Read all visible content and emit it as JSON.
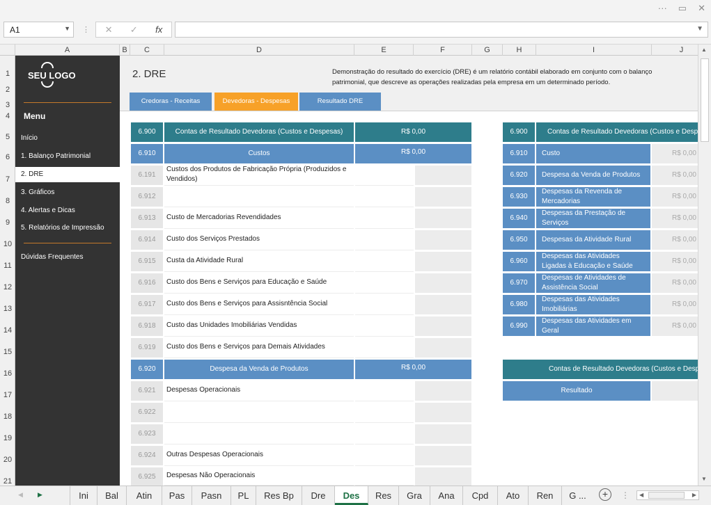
{
  "window": {
    "controls": [
      "···",
      "▭",
      "✕"
    ]
  },
  "formula_bar": {
    "name_box": "A1",
    "fx": "fx",
    "cancel": "✕",
    "confirm": "✓",
    "value": ""
  },
  "columns": [
    "A",
    "B",
    "C",
    "D",
    "E",
    "F",
    "G",
    "H",
    "I",
    "J"
  ],
  "rows": [
    "1",
    "2",
    "3",
    "4",
    "5",
    "6",
    "7",
    "8",
    "9",
    "10",
    "11",
    "12",
    "13",
    "14",
    "15",
    "16",
    "17",
    "18",
    "19",
    "20",
    "21"
  ],
  "sidebar": {
    "logo": "SEU LOGO",
    "menu_title": "Menu",
    "items": [
      {
        "label": "Início"
      },
      {
        "label": "1. Balanço Patrimonial"
      },
      {
        "label": "2. DRE"
      },
      {
        "label": "3. Gráficos"
      },
      {
        "label": "4. Alertas e Dicas"
      },
      {
        "label": "5. Relatórios de Impressão"
      }
    ],
    "faq": "Dúvidas Frequentes"
  },
  "header": {
    "title": "2. DRE",
    "description": "Demonstração do resultado do exercício (DRE) é um relatório contábil elaborado em conjunto com o balanço patrimonial, que descreve as operações realizadas pela empresa em um determinado período.",
    "tabs": [
      {
        "label": "Credoras - Receitas",
        "color": "#5b8fc4"
      },
      {
        "label": "Devedoras - Despesas",
        "color": "#f7a128"
      },
      {
        "label": "Resultado DRE",
        "color": "#5b8fc4"
      }
    ]
  },
  "left_table": {
    "main_header": {
      "code": "6.900",
      "label": "Contas de Resultado Devedoras  (Custos e Despesas)",
      "value": "R$ 0,00"
    },
    "sections": [
      {
        "code": "6.910",
        "label": "Custos",
        "value": "R$ 0,00",
        "rows": [
          {
            "code": "6.191",
            "label": "Custos dos Produtos de Fabricação Própria (Produzidos e Vendidos)"
          },
          {
            "code": "6.912",
            "label": ""
          },
          {
            "code": "6.913",
            "label": "Custo de Mercadorias Revendidades"
          },
          {
            "code": "6.914",
            "label": "Custo dos Serviços Prestados"
          },
          {
            "code": "6.915",
            "label": "Custa da Atividade Rural"
          },
          {
            "code": "6.916",
            "label": "Custo dos Bens e Serviços para Educação e Saúde"
          },
          {
            "code": "6.917",
            "label": "Custo dos Bens e Serviços para Assisntência Social"
          },
          {
            "code": "6.918",
            "label": "Custo das Unidades Imobiliárias Vendidas"
          },
          {
            "code": "6.919",
            "label": "Custo dos Bens e Serviços para Demais Atividades"
          }
        ]
      },
      {
        "code": "6.920",
        "label": "Despesa da Venda de Produtos",
        "value": "R$ 0,00",
        "rows": [
          {
            "code": "6.921",
            "label": "Despesas Operacionais"
          },
          {
            "code": "6.922",
            "label": ""
          },
          {
            "code": "6.923",
            "label": ""
          },
          {
            "code": "6.924",
            "label": "Outras Despesas Operacionais"
          },
          {
            "code": "6.925",
            "label": "Despesas Não Operacionais"
          }
        ]
      }
    ]
  },
  "right_table": {
    "main_header": {
      "code": "6.900",
      "label": "Contas de Resultado Devedoras  (Custos e Despesas)"
    },
    "rows": [
      {
        "code": "6.910",
        "label": "Custo",
        "value": "R$ 0,00"
      },
      {
        "code": "6.920",
        "label": "Despesa da Venda de Produtos",
        "value": "R$ 0,00"
      },
      {
        "code": "6.930",
        "label": "Despesas da Revenda de Mercadorias",
        "value": "R$ 0,00"
      },
      {
        "code": "6.940",
        "label": "Despesas da Prestação de Serviços",
        "value": "R$ 0,00"
      },
      {
        "code": "6.950",
        "label": "Despesas da Atividade Rural",
        "value": "R$ 0,00"
      },
      {
        "code": "6.960",
        "label": "Despesas das Atividades Ligadas à Educação e Saúde",
        "value": "R$ 0,00"
      },
      {
        "code": "6.970",
        "label": "Despesas de Atividades de Assistência Social",
        "value": "R$ 0,00"
      },
      {
        "code": "6.980",
        "label": "Despesas das Atividades Imobiliárias",
        "value": "R$ 0,00"
      },
      {
        "code": "6.990",
        "label": "Despesas das Atividades em Geral",
        "value": "R$ 0,00"
      }
    ],
    "summary_header": "Contas de Resultado Devedoras  (Custos e Despesas)",
    "summary_label": "Resultado"
  },
  "sheet_tabs": [
    "Ini",
    "Bal",
    "Atin",
    "Pas",
    "Pasn",
    "PL",
    "Res Bp",
    "Dre",
    "Des",
    "Res",
    "Gra",
    "Ana",
    "Cpd",
    "Ato",
    "Ren",
    "G ..."
  ],
  "active_sheet": "Des",
  "colors": {
    "teal": "#2e7d8b",
    "blue": "#5b8fc4",
    "orange": "#f7a128",
    "sidebar": "#333333",
    "excel_green": "#1e7145"
  }
}
